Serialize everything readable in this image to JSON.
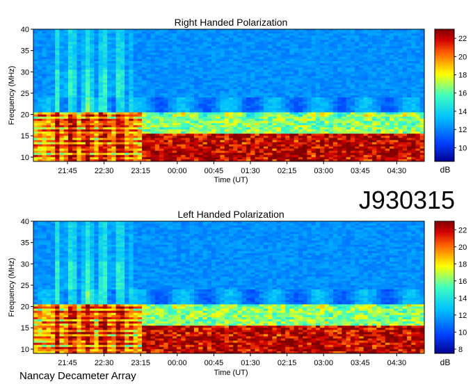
{
  "observation_id": "J930315",
  "instrument": "Nancay Decameter Array",
  "chart_data": [
    {
      "type": "heatmap",
      "title": "Right Handed Polarization",
      "xlabel": "Time (UT)",
      "ylabel": "Frequency (MHz)",
      "x_ticks": [
        "21:45",
        "22:30",
        "23:15",
        "00:00",
        "00:45",
        "01:30",
        "02:15",
        "03:00",
        "03:45",
        "04:30"
      ],
      "y_ticks": [
        10,
        15,
        20,
        25,
        30,
        35,
        40
      ],
      "ylim": [
        9,
        40
      ],
      "colorbar_label": "dB",
      "colorbar_ticks": [
        10,
        12,
        14,
        16,
        18,
        20,
        22
      ],
      "colorbar_range": [
        8.5,
        23
      ],
      "colormap": [
        "#00008f",
        "#0040ff",
        "#00c0ff",
        "#40ffbf",
        "#ffff00",
        "#ff8000",
        "#c00000",
        "#800000"
      ]
    },
    {
      "type": "heatmap",
      "title": "Left Handed Polarization",
      "xlabel": "Time (UT)",
      "ylabel": "Frequency (MHz)",
      "x_ticks": [
        "21:45",
        "22:30",
        "23:15",
        "00:00",
        "00:45",
        "01:30",
        "02:15",
        "03:00",
        "03:45",
        "04:30"
      ],
      "y_ticks": [
        10,
        15,
        20,
        25,
        30,
        35,
        40
      ],
      "ylim": [
        9,
        40
      ],
      "colorbar_label": "dB",
      "colorbar_ticks": [
        8,
        10,
        12,
        14,
        16,
        18,
        20,
        22
      ],
      "colorbar_range": [
        7.5,
        23
      ],
      "colormap": [
        "#00008f",
        "#0040ff",
        "#00c0ff",
        "#40ffbf",
        "#ffff00",
        "#ff8000",
        "#c00000",
        "#800000"
      ]
    }
  ]
}
